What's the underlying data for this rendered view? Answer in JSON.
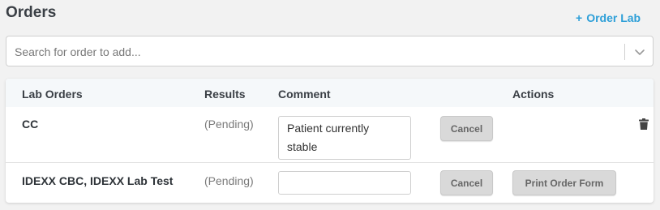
{
  "header": {
    "title": "Orders",
    "order_lab_plus": "+",
    "order_lab_label": "Order Lab"
  },
  "search": {
    "placeholder": "Search for order to add..."
  },
  "table": {
    "columns": [
      "Lab Orders",
      "Results",
      "Comment",
      "Actions"
    ],
    "rows": [
      {
        "name": "CC",
        "result": "(Pending)",
        "comment": "Patient currently stable",
        "cancel_label": "Cancel"
      },
      {
        "name": "IDEXX CBC, IDEXX Lab Test",
        "result": "(Pending)",
        "comment": "",
        "cancel_label": "Cancel",
        "print_label": "Print Order Form"
      }
    ]
  },
  "icons": {
    "dropdown": "chevron-down-icon",
    "delete": "trash-icon"
  },
  "colors": {
    "accent": "#2d9fd8",
    "button_bg": "#d9d9d9",
    "header_bg": "#f5f8fa"
  }
}
